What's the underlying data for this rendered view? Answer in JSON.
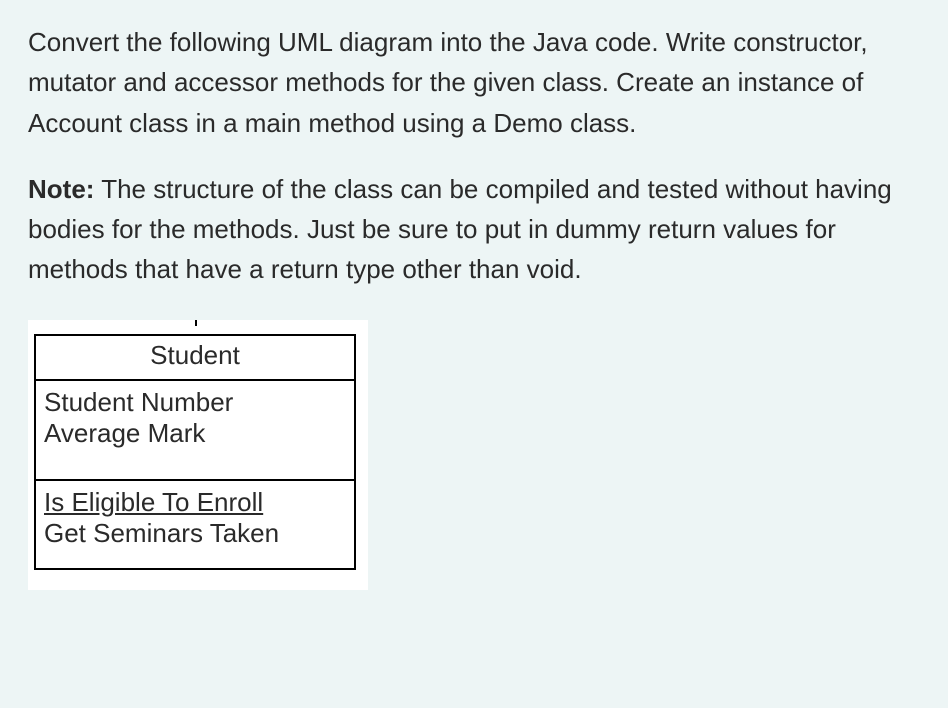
{
  "paragraph1_parts": {
    "p1": "Convert the following UML diagram into the Java code. Write constructor, mutator and accessor methods for the given class. Create an instance of Account class  in a main method using a Demo class."
  },
  "paragraph2_parts": {
    "bold": "Note:",
    "rest": " The structure of the class can be compiled and tested without having bodies for the methods. Just be sure to put in dummy return values for methods that have a return type other than void."
  },
  "uml": {
    "class_name": "Student",
    "attributes": [
      "Student Number",
      "Average Mark"
    ],
    "operations": [
      {
        "name": "Is Eligible To Enroll",
        "underlined": true
      },
      {
        "name": "Get Seminars Taken",
        "underlined": false
      }
    ]
  }
}
